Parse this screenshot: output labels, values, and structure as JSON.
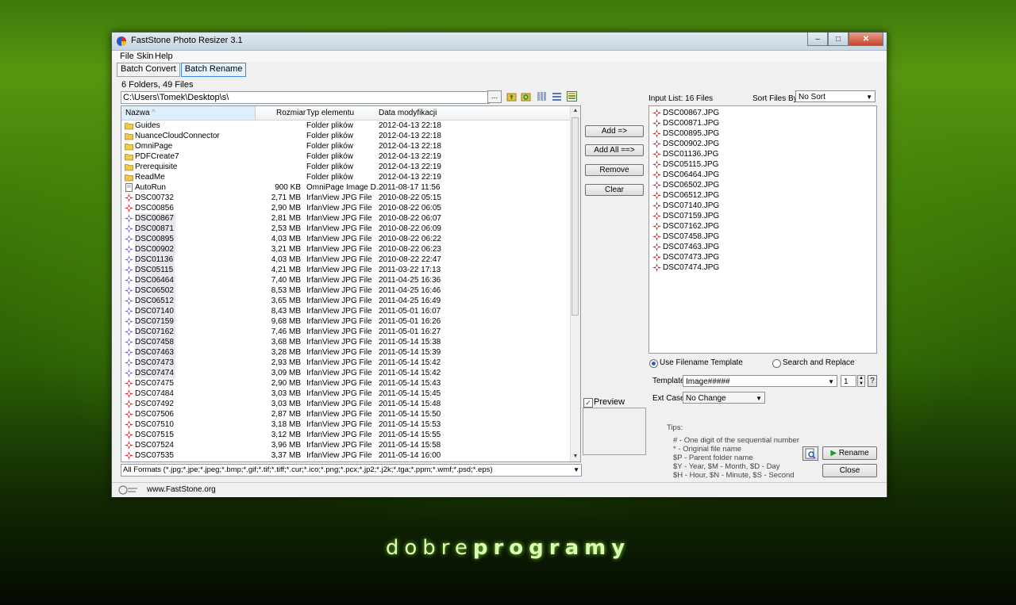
{
  "window": {
    "title": "FastStone Photo Resizer 3.1",
    "close_glyph": "✕",
    "max_glyph": "□",
    "min_glyph": "–"
  },
  "menu": [
    "File",
    "Skin",
    "Help"
  ],
  "tabs": [
    "Batch Convert",
    "Batch Rename"
  ],
  "browser": {
    "folder_count": "6 Folders, 49 Files",
    "path": "C:\\Users\\Tomek\\Desktop\\s\\",
    "browse_label": "...",
    "columns": {
      "name": "Nazwa",
      "size": "Rozmiar",
      "type": "Typ elementu",
      "date": "Data modyfikacji"
    },
    "rows": [
      {
        "name": "Guides",
        "size": "",
        "type": "Folder plików",
        "date": "2012-04-13 22:18",
        "kind": "folder"
      },
      {
        "name": "NuanceCloudConnector",
        "size": "",
        "type": "Folder plików",
        "date": "2012-04-13 22:18",
        "kind": "folder"
      },
      {
        "name": "OmniPage",
        "size": "",
        "type": "Folder plików",
        "date": "2012-04-13 22:18",
        "kind": "folder"
      },
      {
        "name": "PDFCreate7",
        "size": "",
        "type": "Folder plików",
        "date": "2012-04-13 22:19",
        "kind": "folder"
      },
      {
        "name": "Prerequisite",
        "size": "",
        "type": "Folder plików",
        "date": "2012-04-13 22:19",
        "kind": "folder"
      },
      {
        "name": "ReadMe",
        "size": "",
        "type": "Folder plików",
        "date": "2012-04-13 22:19",
        "kind": "folder"
      },
      {
        "name": "AutoRun",
        "size": "900 KB",
        "type": "OmniPage Image D...",
        "date": "2011-08-17 11:56",
        "kind": "doc"
      },
      {
        "name": "DSC00732",
        "size": "2,71 MB",
        "type": "IrfanView JPG File",
        "date": "2010-08-22 05:15",
        "kind": "jpg"
      },
      {
        "name": "DSC00856",
        "size": "2,90 MB",
        "type": "IrfanView JPG File",
        "date": "2010-08-22 06:05",
        "kind": "jpg"
      },
      {
        "name": "DSC00867",
        "size": "2,81 MB",
        "type": "IrfanView JPG File",
        "date": "2010-08-22 06:07",
        "kind": "jpg-sel"
      },
      {
        "name": "DSC00871",
        "size": "2,53 MB",
        "type": "IrfanView JPG File",
        "date": "2010-08-22 06:09",
        "kind": "jpg-sel"
      },
      {
        "name": "DSC00895",
        "size": "4,03 MB",
        "type": "IrfanView JPG File",
        "date": "2010-08-22 06:22",
        "kind": "jpg-sel"
      },
      {
        "name": "DSC00902",
        "size": "3,21 MB",
        "type": "IrfanView JPG File",
        "date": "2010-08-22 06:23",
        "kind": "jpg-sel"
      },
      {
        "name": "DSC01136",
        "size": "4,03 MB",
        "type": "IrfanView JPG File",
        "date": "2010-08-22 22:47",
        "kind": "jpg-sel"
      },
      {
        "name": "DSC05115",
        "size": "4,21 MB",
        "type": "IrfanView JPG File",
        "date": "2011-03-22 17:13",
        "kind": "jpg-sel"
      },
      {
        "name": "DSC06464",
        "size": "7,40 MB",
        "type": "IrfanView JPG File",
        "date": "2011-04-25 16:36",
        "kind": "jpg-sel"
      },
      {
        "name": "DSC06502",
        "size": "8,53 MB",
        "type": "IrfanView JPG File",
        "date": "2011-04-25 16:46",
        "kind": "jpg-sel"
      },
      {
        "name": "DSC06512",
        "size": "3,65 MB",
        "type": "IrfanView JPG File",
        "date": "2011-04-25 16:49",
        "kind": "jpg-sel"
      },
      {
        "name": "DSC07140",
        "size": "8,43 MB",
        "type": "IrfanView JPG File",
        "date": "2011-05-01 16:07",
        "kind": "jpg-sel"
      },
      {
        "name": "DSC07159",
        "size": "9,68 MB",
        "type": "IrfanView JPG File",
        "date": "2011-05-01 16:26",
        "kind": "jpg-sel"
      },
      {
        "name": "DSC07162",
        "size": "7,46 MB",
        "type": "IrfanView JPG File",
        "date": "2011-05-01 16:27",
        "kind": "jpg-sel"
      },
      {
        "name": "DSC07458",
        "size": "3,68 MB",
        "type": "IrfanView JPG File",
        "date": "2011-05-14 15:38",
        "kind": "jpg-sel"
      },
      {
        "name": "DSC07463",
        "size": "3,28 MB",
        "type": "IrfanView JPG File",
        "date": "2011-05-14 15:39",
        "kind": "jpg-sel"
      },
      {
        "name": "DSC07473",
        "size": "2,93 MB",
        "type": "IrfanView JPG File",
        "date": "2011-05-14 15:42",
        "kind": "jpg-sel"
      },
      {
        "name": "DSC07474",
        "size": "3,09 MB",
        "type": "IrfanView JPG File",
        "date": "2011-05-14 15:42",
        "kind": "jpg-sel"
      },
      {
        "name": "DSC07475",
        "size": "2,90 MB",
        "type": "IrfanView JPG File",
        "date": "2011-05-14 15:43",
        "kind": "jpg"
      },
      {
        "name": "DSC07484",
        "size": "3,03 MB",
        "type": "IrfanView JPG File",
        "date": "2011-05-14 15:45",
        "kind": "jpg"
      },
      {
        "name": "DSC07492",
        "size": "3,03 MB",
        "type": "IrfanView JPG File",
        "date": "2011-05-14 15:48",
        "kind": "jpg"
      },
      {
        "name": "DSC07506",
        "size": "2,87 MB",
        "type": "IrfanView JPG File",
        "date": "2011-05-14 15:50",
        "kind": "jpg"
      },
      {
        "name": "DSC07510",
        "size": "3,18 MB",
        "type": "IrfanView JPG File",
        "date": "2011-05-14 15:53",
        "kind": "jpg"
      },
      {
        "name": "DSC07515",
        "size": "3,12 MB",
        "type": "IrfanView JPG File",
        "date": "2011-05-14 15:55",
        "kind": "jpg"
      },
      {
        "name": "DSC07524",
        "size": "3,96 MB",
        "type": "IrfanView JPG File",
        "date": "2011-05-14 15:58",
        "kind": "jpg"
      },
      {
        "name": "DSC07535",
        "size": "3,37 MB",
        "type": "IrfanView JPG File",
        "date": "2011-05-14 16:00",
        "kind": "jpg"
      }
    ],
    "filter": "All Formats (*.jpg;*.jpe;*.jpeg;*.bmp;*.gif;*.tif;*.tiff;*.cur;*.ico;*.png;*.pcx;*.jp2;*.j2k;*.tga;*.ppm;*.wmf;*.psd;*.eps)"
  },
  "actions": {
    "add": "Add =>",
    "add_all": "Add All ==>",
    "remove": "Remove",
    "clear": "Clear"
  },
  "preview": {
    "label": "Preview",
    "checked": true
  },
  "input": {
    "label": "Input List:  16 Files",
    "sort_label": "Sort Files By:",
    "sort_value": "No Sort",
    "files": [
      "DSC00867.JPG",
      "DSC00871.JPG",
      "DSC00895.JPG",
      "DSC00902.JPG",
      "DSC01136.JPG",
      "DSC05115.JPG",
      "DSC06464.JPG",
      "DSC06502.JPG",
      "DSC06512.JPG",
      "DSC07140.JPG",
      "DSC07159.JPG",
      "DSC07162.JPG",
      "DSC07458.JPG",
      "DSC07463.JPG",
      "DSC07473.JPG",
      "DSC07474.JPG"
    ]
  },
  "rename": {
    "option_template": "Use Filename Template",
    "option_replace": "Search and Replace",
    "template_label": "Template:",
    "template_value": "Image#####",
    "start_number": "1",
    "help_label": "?",
    "ext_label": "Ext Case:",
    "ext_value": "No Change",
    "tips_title": "Tips:",
    "tips": [
      "#  - One digit of the sequential number",
      "*  - Original file name",
      "$P - Parent folder name",
      "$Y - Year,     $M - Month,     $D - Day",
      "$H - Hour,     $N - Minute,    $S - Second"
    ],
    "rename_button": "Rename",
    "close_button": "Close"
  },
  "status": {
    "site": "www.FastStone.org"
  },
  "wallpaper": {
    "brand_light": "dobre",
    "brand_bold": "programy"
  }
}
